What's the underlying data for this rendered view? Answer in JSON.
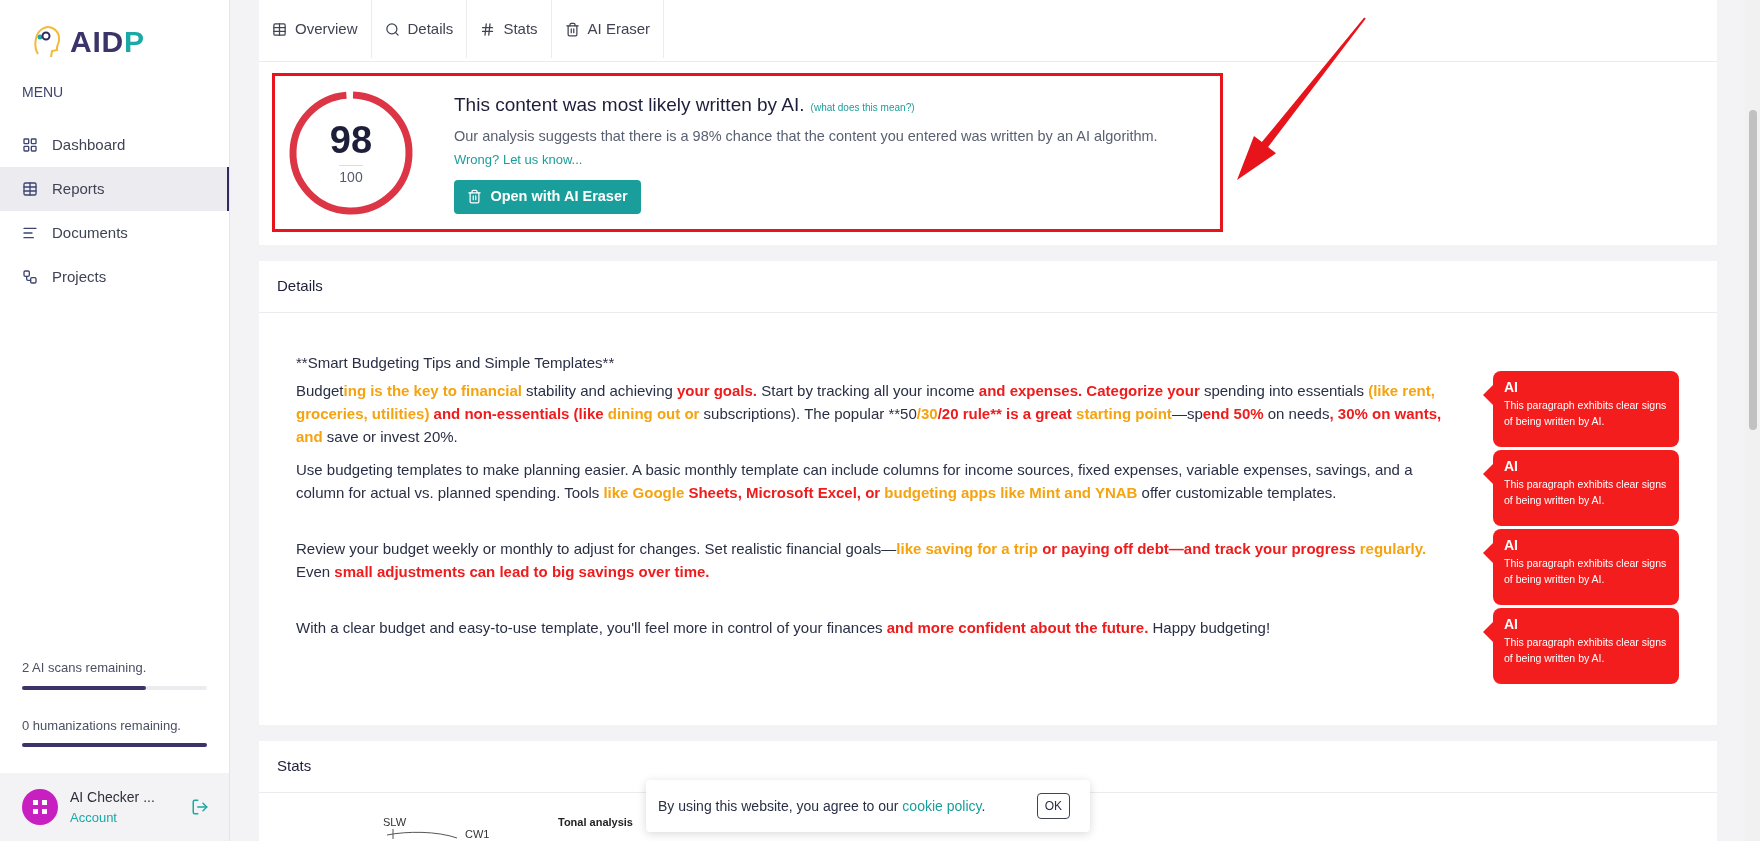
{
  "sidebar": {
    "logo": {
      "main": "AID",
      "accent": "P"
    },
    "menu_title": "MENU",
    "items": [
      {
        "label": "Dashboard",
        "selected": false
      },
      {
        "label": "Reports",
        "selected": true
      },
      {
        "label": "Documents",
        "selected": false
      },
      {
        "label": "Projects",
        "selected": false
      }
    ],
    "quotas": [
      {
        "label": "2 AI scans remaining.",
        "level": 0.67
      },
      {
        "label": "0 humanizations remaining.",
        "level": 1
      }
    ],
    "account": {
      "name": "AI Checker ...",
      "link": "Account"
    }
  },
  "tabs": [
    {
      "label": "Overview"
    },
    {
      "label": "Details"
    },
    {
      "label": "Stats"
    },
    {
      "label": "AI Eraser"
    }
  ],
  "overview": {
    "score": "98",
    "max": "100",
    "level": 0.98,
    "title": "This content was most likely written by AI.",
    "help_link": "(what does this mean?)",
    "description": "Our analysis suggests that there is a 98% chance that the content you entered was written by an AI algorithm.",
    "feedback_link": "Wrong? Let us know...",
    "button": "Open with AI Eraser"
  },
  "details": {
    "title": "Details",
    "heading": "**Smart Budgeting Tips and Simple Templates**",
    "paragraphs": [
      {
        "badge": {
          "title": "AI",
          "text": "This paragraph exhibits clear signs of being written by AI."
        },
        "segments": [
          {
            "text": "Budget",
            "kind": "plain"
          },
          {
            "text": "ing is the key to financial",
            "kind": "flag",
            "color": "#f5a30f"
          },
          {
            "text": " stability and achieving ",
            "kind": "plain"
          },
          {
            "text": "your goals.",
            "kind": "flag",
            "color": "#ee1c1c"
          },
          {
            "text": " Start by tracking all your income ",
            "kind": "plain"
          },
          {
            "text": "and expenses.",
            "kind": "flag",
            "color": "#ee1c1c"
          },
          {
            "text": " Categorize your",
            "kind": "flag",
            "color": "#ee1c1c"
          },
          {
            "text": " spending into essentials ",
            "kind": "plain"
          },
          {
            "text": "(like rent, groceries, utilities)",
            "kind": "flag",
            "color": "#f5a30f"
          },
          {
            "text": " and non-essentials (like",
            "kind": "flag",
            "color": "#ee1c1c"
          },
          {
            "text": " dining out or",
            "kind": "flag",
            "color": "#f5a30f"
          },
          {
            "text": " subscriptions). The popular **50",
            "kind": "plain"
          },
          {
            "text": "/30",
            "kind": "flag",
            "color": "#f5a30f"
          },
          {
            "text": "/20 rule** is a great",
            "kind": "flag",
            "color": "#ee1c1c"
          },
          {
            "text": " starting point",
            "kind": "flag",
            "color": "#f5a30f"
          },
          {
            "text": "—sp",
            "kind": "plain"
          },
          {
            "text": "end 50%",
            "kind": "flag",
            "color": "#ee1c1c"
          },
          {
            "text": " on needs",
            "kind": "plain"
          },
          {
            "text": ", 30% on wants,",
            "kind": "flag",
            "color": "#ee1c1c"
          },
          {
            "text": " and",
            "kind": "flag",
            "color": "#f5a30f"
          },
          {
            "text": " save or invest 20%.",
            "kind": "plain"
          }
        ]
      },
      {
        "badge": {
          "title": "AI",
          "text": "This paragraph exhibits clear signs of being written by AI."
        },
        "segments": [
          {
            "text": "Use budgeting templates to make planning easier. A basic monthly template can include columns for income sources, fixed expenses, variable expenses, savings, and a column for actual vs. planned spending. Tools ",
            "kind": "plain"
          },
          {
            "text": "like Google",
            "kind": "flag",
            "color": "#f5a30f"
          },
          {
            "text": " Sheets, Microsoft Excel, or",
            "kind": "flag",
            "color": "#ee1c1c"
          },
          {
            "text": " budgeting apps like Mint and YNAB",
            "kind": "flag",
            "color": "#f5a30f"
          },
          {
            "text": " offer customizable templates.",
            "kind": "plain"
          }
        ]
      },
      {
        "badge": {
          "title": "AI",
          "text": "This paragraph exhibits clear signs of being written by AI."
        },
        "segments": [
          {
            "text": "Review your budget weekly or monthly to adjust for changes. Set realistic financial goals—",
            "kind": "plain"
          },
          {
            "text": "like saving for a trip",
            "kind": "flag",
            "color": "#f5a30f"
          },
          {
            "text": " or paying off debt—and track your progress",
            "kind": "flag",
            "color": "#ee1c1c"
          },
          {
            "text": " regularly.",
            "kind": "flag",
            "color": "#f5a30f"
          },
          {
            "text": " Even ",
            "kind": "plain"
          },
          {
            "text": "small adjustments can lead to big savings over time.",
            "kind": "flag",
            "color": "#ee1c1c"
          }
        ]
      },
      {
        "badge": {
          "title": "AI",
          "text": "This paragraph exhibits clear signs of being written by AI."
        },
        "segments": [
          {
            "text": "With a clear budget and easy-to-use template, you'll feel more in control of your finances ",
            "kind": "plain"
          },
          {
            "text": "and more confident about the future.",
            "kind": "flag",
            "color": "#ee1c1c"
          },
          {
            "text": " Happy budgeting!",
            "kind": "plain"
          }
        ]
      }
    ]
  },
  "stats": {
    "title": "Stats",
    "axis_labels": [
      "SLW",
      "CW1"
    ],
    "chart_title": "Tonal analysis"
  },
  "cookie": {
    "text": "By using this website, you agree to our ",
    "link": "cookie policy",
    "end": ".",
    "button": "OK"
  }
}
